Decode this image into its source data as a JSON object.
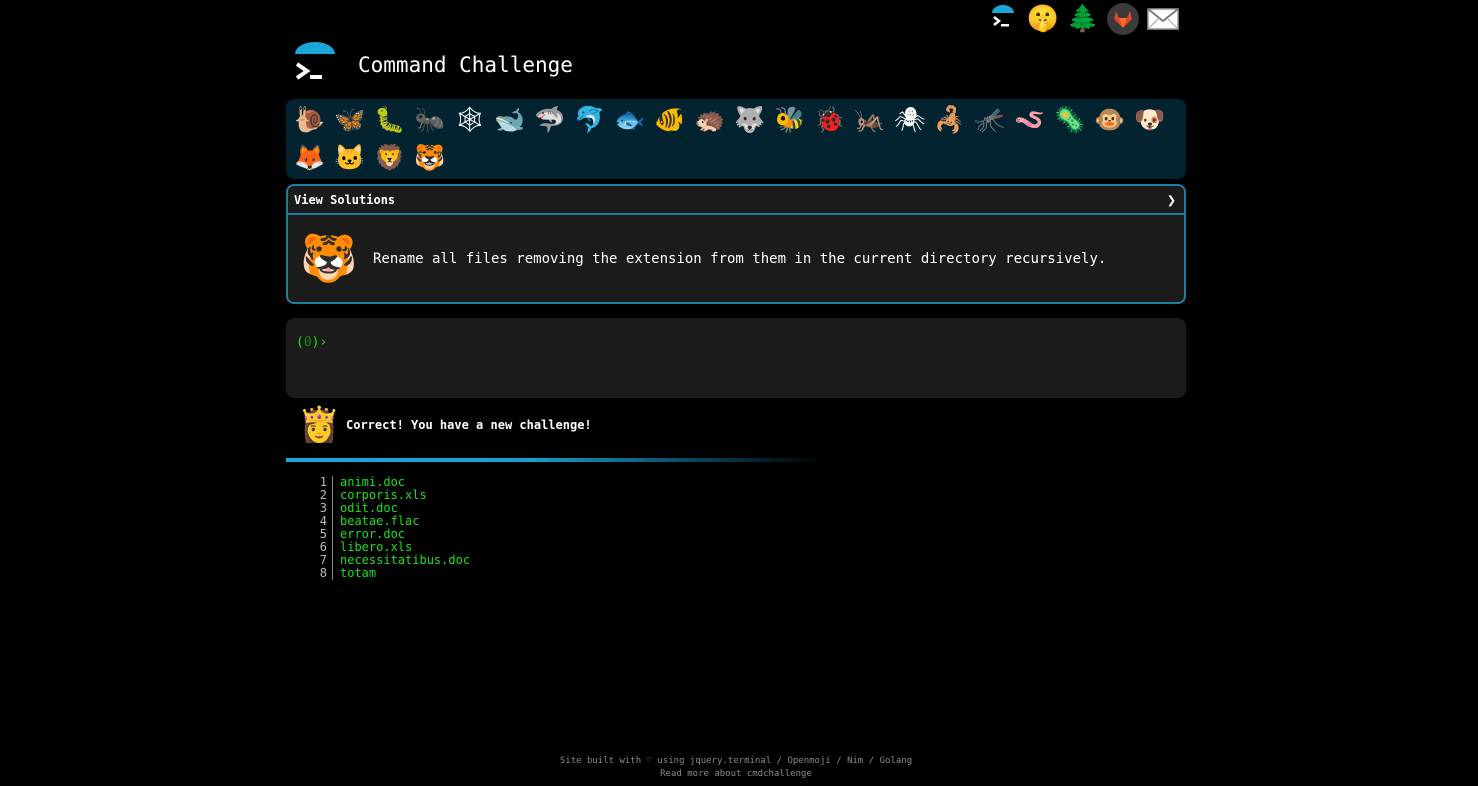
{
  "app": {
    "title": "Command Challenge"
  },
  "topnav": {
    "icons": [
      {
        "name": "cmdchallenge-icon",
        "glyph": ""
      },
      {
        "name": "shushing-face-icon",
        "glyph": "🤫"
      },
      {
        "name": "tree-icon",
        "glyph": "🌲"
      },
      {
        "name": "gitlab-icon",
        "glyph": ""
      },
      {
        "name": "envelope-icon",
        "glyph": "✉"
      }
    ]
  },
  "emoji_bar": {
    "items": [
      "🐌",
      "🦋",
      "🐛",
      "🐜",
      "🕸",
      "🐋",
      "🦈",
      "🐬",
      "🐟",
      "🐠",
      "🦔",
      "🐺",
      "🐝",
      "🐞",
      "🦗",
      "🕷",
      "🦂",
      "🦟",
      "🪱",
      "🦠",
      "🐵",
      "🐶",
      "🦊",
      "🐱",
      "🦁",
      "🐯"
    ]
  },
  "challenge": {
    "header_label": "View Solutions",
    "chevron": "❯",
    "emoji": "🐯",
    "description": "Rename all files removing the extension from them in the current directory recursively."
  },
  "terminal": {
    "prompt_open": "(",
    "prompt_count": "0",
    "prompt_close": ")›"
  },
  "result": {
    "emoji": "👸",
    "message": "Correct! You have a new challenge!",
    "progress_fraction": 0.6
  },
  "files": [
    {
      "num": "1",
      "name": "animi.doc"
    },
    {
      "num": "2",
      "name": "corporis.xls"
    },
    {
      "num": "3",
      "name": "odit.doc"
    },
    {
      "num": "4",
      "name": "beatae.flac"
    },
    {
      "num": "5",
      "name": "error.doc"
    },
    {
      "num": "6",
      "name": "libero.xls"
    },
    {
      "num": "7",
      "name": "necessitatibus.doc"
    },
    {
      "num": "8",
      "name": "totam"
    }
  ],
  "footer": {
    "line1_prefix": "Site built with ♡ using ",
    "links": [
      "jquery.terminal",
      "Openmoji",
      "Nim",
      "Golang"
    ],
    "separator": " / ",
    "line2": "Read more about cmdchallenge"
  },
  "colors": {
    "accent": "#1b7fa4",
    "terminal_green": "#1be01b",
    "emoji_bar_bg": "#042330",
    "panel_bg": "#1b1b1b"
  }
}
